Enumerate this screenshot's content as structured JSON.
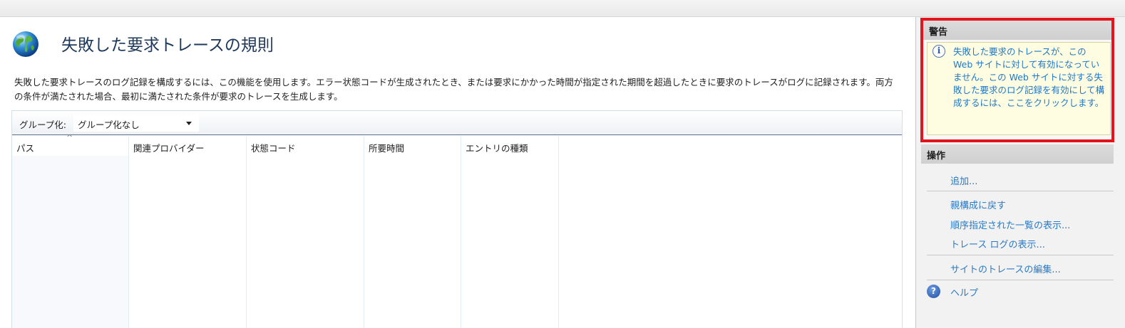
{
  "page": {
    "title": "失敗した要求トレースの規則",
    "description": "失敗した要求トレースのログ記録を構成するには、この機能を使用します。エラー状態コードが生成されたとき、または要求にかかった時間が指定された期間を超過したときに要求のトレースがログに記録されます。両方の条件が満たされた場合、最初に満たされた条件が要求のトレースを生成します。"
  },
  "group": {
    "label": "グループ化:",
    "value": "グループ化なし"
  },
  "columns": [
    "パス",
    "関連プロバイダー",
    "状態コード",
    "所要時間",
    "エントリの種類"
  ],
  "sort_indicator": "^",
  "sidebar": {
    "warning_title": "警告",
    "warning_text": "失敗した要求のトレースが、この Web サイトに対して有効になっていません。この Web サイトに対する失敗した要求のログ記録を有効にして構成するには、ここをクリックします。",
    "actions_title": "操作",
    "actions": [
      "追加...",
      "親構成に戻す",
      "順序指定された一覧の表示...",
      "トレース ログの表示...",
      "サイトのトレースの編集...",
      "ヘルプ"
    ]
  },
  "colors": {
    "warning_border": "#e3141b",
    "link": "#2a7ac6",
    "warning_bg": "#fffde1"
  }
}
